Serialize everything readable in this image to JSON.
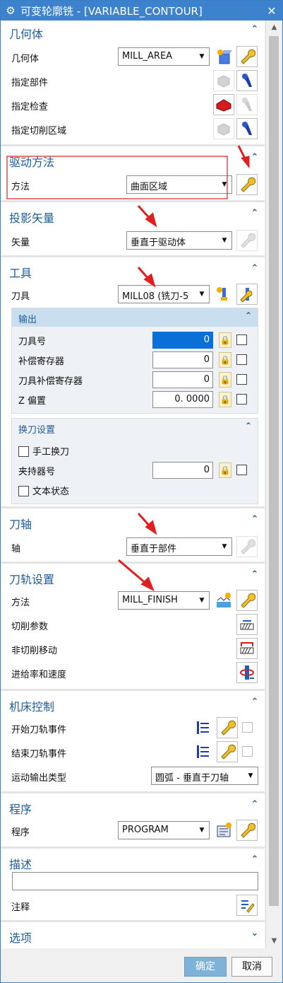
{
  "window": {
    "title": "可变轮廓铣 - [VARIABLE_CONTOUR]",
    "close": "✕"
  },
  "geometry": {
    "header": "几何体",
    "geom_label": "几何体",
    "geom_value": "MILL_AREA",
    "part_label": "指定部件",
    "check_label": "指定检查",
    "cut_area_label": "指定切削区域"
  },
  "drive": {
    "header": "驱动方法",
    "method_label": "方法",
    "method_value": "曲面区域"
  },
  "projection": {
    "header": "投影矢量",
    "vector_label": "矢量",
    "vector_value": "垂直于驱动体"
  },
  "tool": {
    "header": "工具",
    "tool_label": "刀具",
    "tool_value": "MILL08 (铣刀-5",
    "output": {
      "header": "输出",
      "tool_num_label": "刀具号",
      "tool_num_value": "0",
      "adj_reg_label": "补偿寄存器",
      "adj_reg_value": "0",
      "cutcom_label": "刀具补偿寄存器",
      "cutcom_value": "0",
      "zoffset_label": "Z 偏置",
      "zoffset_value": "0. 0000"
    },
    "change": {
      "header": "换刀设置",
      "manual_label": "手工换刀",
      "holder_label": "夹持器号",
      "holder_value": "0",
      "text_status_label": "文本状态"
    }
  },
  "axis": {
    "header": "刀轴",
    "axis_label": "轴",
    "axis_value": "垂直于部件"
  },
  "path": {
    "header": "刀轨设置",
    "method_label": "方法",
    "method_value": "MILL_FINISH",
    "cut_params_label": "切削参数",
    "noncut_label": "非切削移动",
    "feeds_label": "进给率和速度"
  },
  "machine": {
    "header": "机床控制",
    "start_label": "开始刀轨事件",
    "end_label": "结束刀轨事件",
    "motion_label": "运动输出类型",
    "motion_value": "圆弧 - 垂直于刀轴"
  },
  "program": {
    "header": "程序",
    "program_label": "程序",
    "program_value": "PROGRAM"
  },
  "desc": {
    "header": "描述",
    "desc_value": "",
    "note_label": "注释"
  },
  "options": {
    "header": "选项"
  },
  "footer": {
    "ok": "确定",
    "cancel": "取消"
  },
  "colors": {
    "title_bar": "#3c82cc",
    "section_text": "#1f5c99",
    "annotation_red": "#e02020",
    "sub_header": "#c9dff0"
  }
}
